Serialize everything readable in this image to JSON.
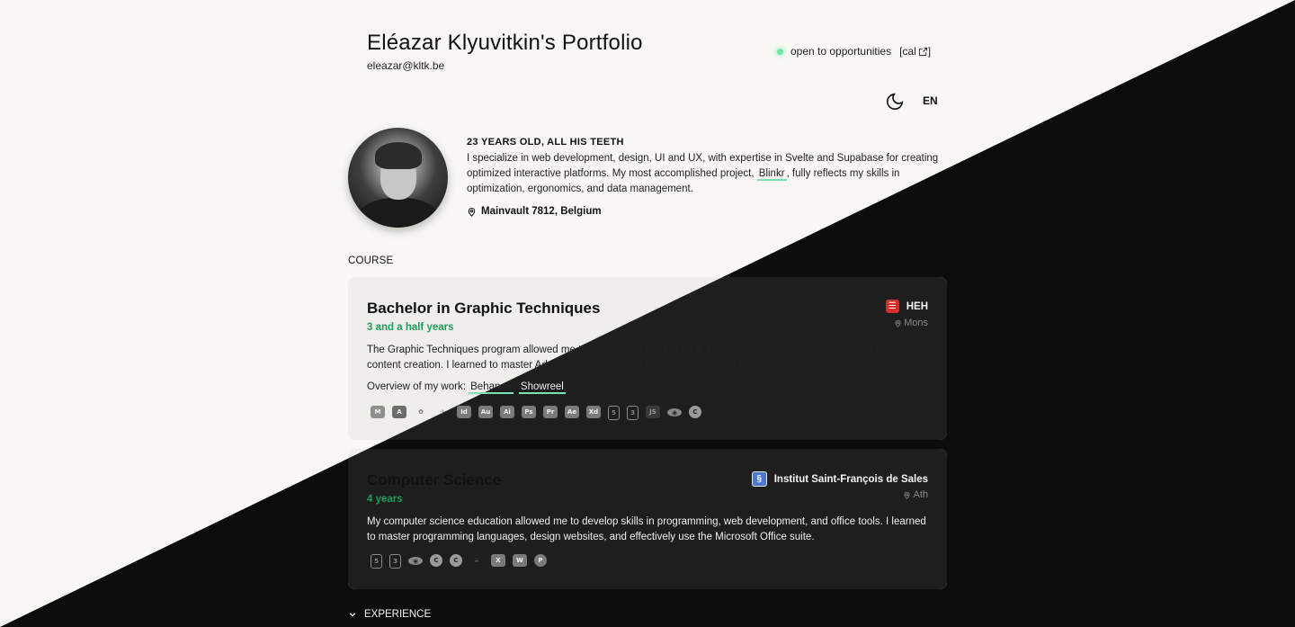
{
  "header": {
    "title": "Eléazar Klyuvitkin's Portfolio",
    "email": "eleazar@kltk.be",
    "status": "open to opportunities",
    "cal_label": "[cal",
    "cal_close": "]",
    "status_color": "#6ee7a5",
    "lang": "EN"
  },
  "profile": {
    "age_line": "23 YEARS OLD, ALL HIS TEETH",
    "bio_part1": "I specialize in web development, design, UI and UX, with expertise in Svelte and Supabase for creating optimized interactive platforms. My most accomplished project,",
    "bio_link": "Blinkr",
    "bio_part2": ", fully reflects my skills in optimization, ergonomics, and data management.",
    "location": "Mainvault 7812, Belgium"
  },
  "sections": {
    "course": "COURSE",
    "experience": "EXPERIENCE"
  },
  "courses": [
    {
      "title": "Bachelor in Graphic Techniques",
      "duration": "3 and a half years",
      "school": "HEH",
      "school_logo_color": "#d62d2d",
      "city": "Mons",
      "description": "The Graphic Techniques program allowed me to develop my skills in 2d & 3d, visual communication, and multimedia content creation. I learned to master Adobe software, design user interfaces, and create high-quality graphic projects.",
      "overview_label": "Overview of my work:",
      "links": [
        "Behance",
        "Showreel"
      ],
      "tools": [
        "M",
        "A",
        "✿",
        "✈",
        "Id",
        "Au",
        "Ai",
        "Ps",
        "Pr",
        "Ae",
        "Xd",
        "5",
        "3",
        "JS",
        "◉",
        "C"
      ]
    },
    {
      "title": "Computer Science",
      "duration": "4 years",
      "school": "Institut Saint-François de Sales",
      "school_logo_color": "#4a79c9",
      "city": "Ath",
      "description": "My computer science education allowed me to develop skills in programming, web development, and office tools. I learned to master programming languages, design websites, and effectively use the Microsoft Office suite.",
      "tools": [
        "5",
        "3",
        "◉",
        "C",
        "C",
        "☕",
        "X",
        "W",
        "P"
      ]
    }
  ],
  "colors": {
    "accent_green": "#1f9e5a",
    "link_underline": "#7ee0b0",
    "dark_bg": "#0c0c0c",
    "light_bg": "#f8f7f3"
  }
}
